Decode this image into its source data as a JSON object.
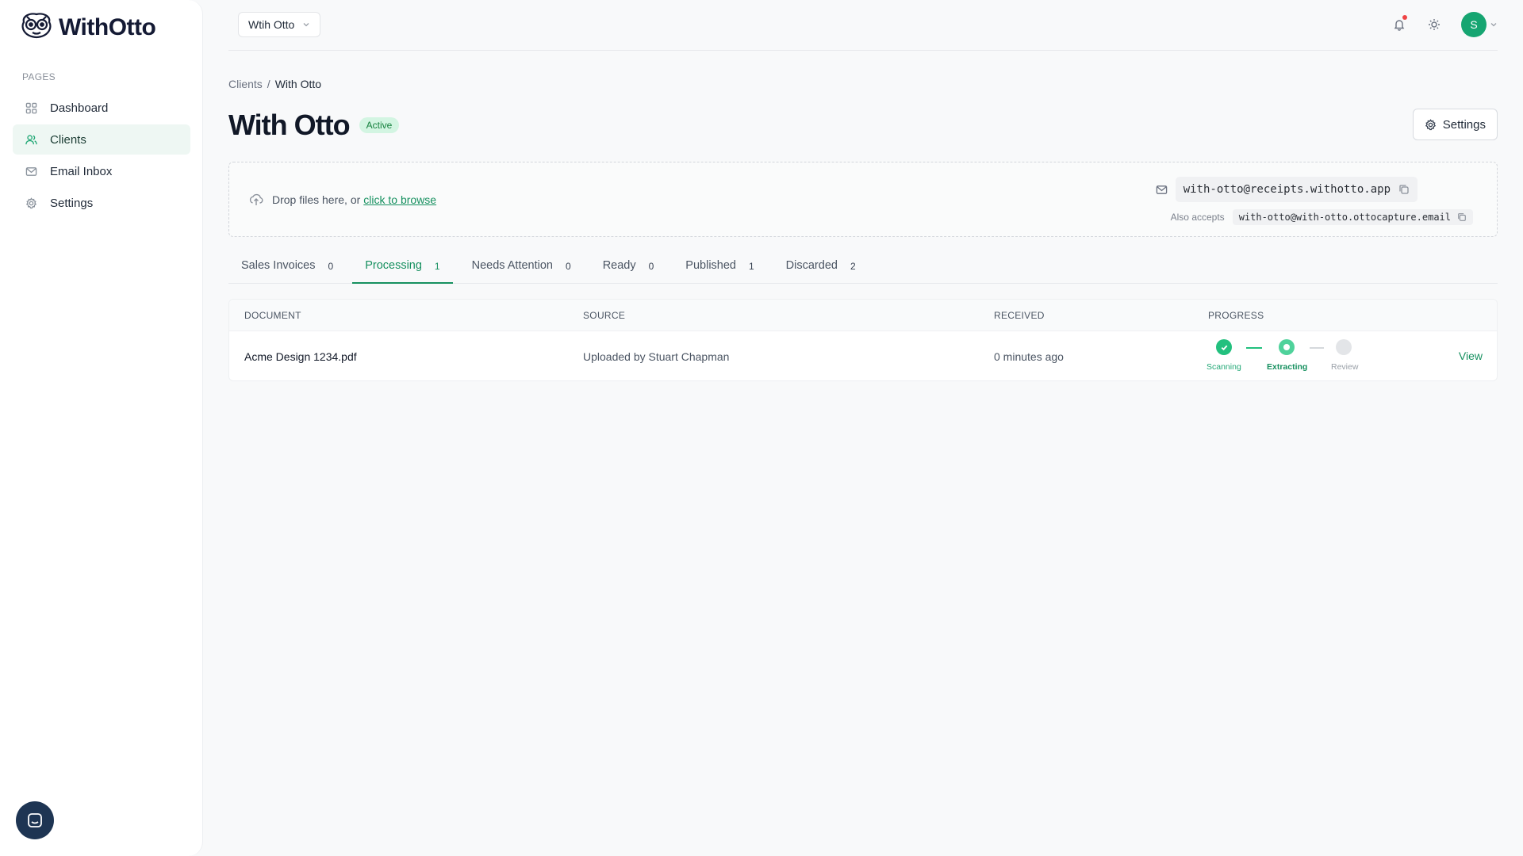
{
  "brand": {
    "name": "WithOtto"
  },
  "sidebar": {
    "section_label": "PAGES",
    "items": [
      {
        "label": "Dashboard",
        "icon": "grid-icon",
        "active": false
      },
      {
        "label": "Clients",
        "icon": "users-icon",
        "active": true
      },
      {
        "label": "Email Inbox",
        "icon": "mail-icon",
        "active": false
      },
      {
        "label": "Settings",
        "icon": "gear-icon",
        "active": false
      }
    ]
  },
  "topbar": {
    "client_selector": "Wtih Otto",
    "avatar_initial": "S"
  },
  "breadcrumb": {
    "parent": "Clients",
    "separator": "/",
    "current": "With Otto"
  },
  "page": {
    "title": "With Otto",
    "status": "Active",
    "settings_label": "Settings"
  },
  "dropzone": {
    "text": "Drop files here, or",
    "link": "click to browse",
    "email": "with-otto@receipts.withotto.app",
    "also_label": "Also accepts",
    "alt_email": "with-otto@with-otto.ottocapture.email"
  },
  "tabs": [
    {
      "label": "Sales Invoices",
      "count": "0"
    },
    {
      "label": "Processing",
      "count": "1"
    },
    {
      "label": "Needs Attention",
      "count": "0"
    },
    {
      "label": "Ready",
      "count": "0"
    },
    {
      "label": "Published",
      "count": "1"
    },
    {
      "label": "Discarded",
      "count": "2"
    }
  ],
  "table": {
    "headers": {
      "document": "DOCUMENT",
      "source": "SOURCE",
      "received": "RECEIVED",
      "progress": "PROGRESS"
    },
    "rows": [
      {
        "document": "Acme Design 1234.pdf",
        "source": "Uploaded by Stuart Chapman",
        "received": "0 minutes ago",
        "steps": [
          {
            "label": "Scanning",
            "state": "done"
          },
          {
            "label": "Extracting",
            "state": "current"
          },
          {
            "label": "Review",
            "state": "pending"
          }
        ],
        "action": "View"
      }
    ]
  },
  "colors": {
    "accent": "#16905f",
    "avatar": "#16a571",
    "badge_bg": "#d3f5e2"
  }
}
